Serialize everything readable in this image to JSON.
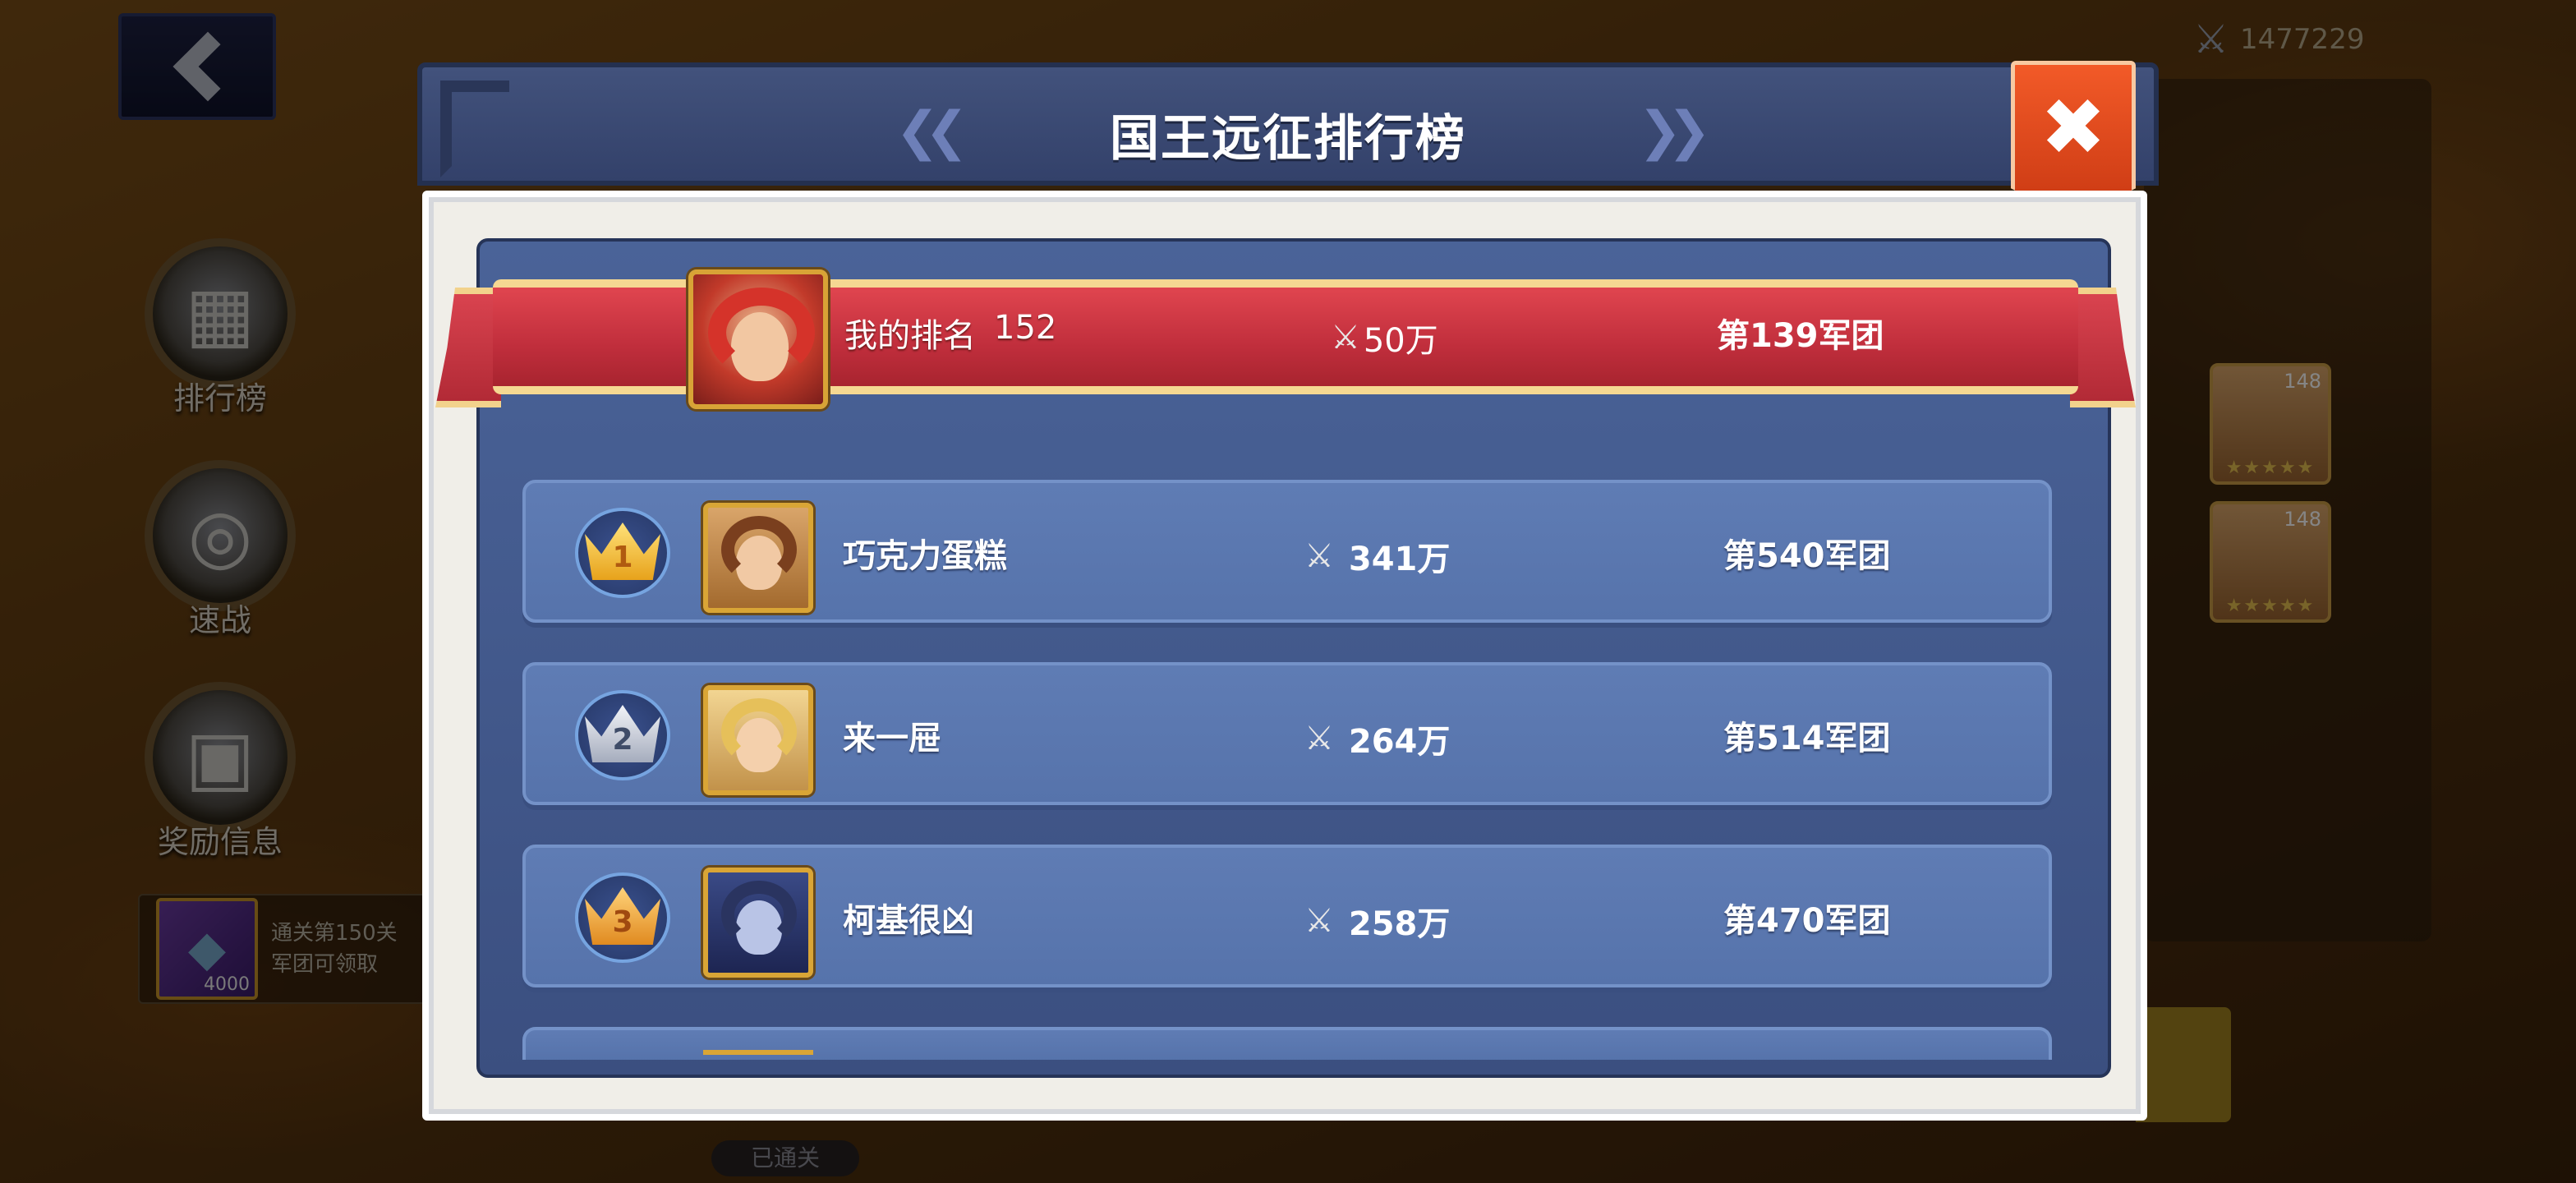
{
  "background": {
    "power_total": "1477229",
    "side_menu": [
      {
        "label": "排行榜"
      },
      {
        "label": "速战"
      },
      {
        "label": "奖励信息"
      }
    ],
    "reward": {
      "text_line1": "通关第150关",
      "text_line2": "军团可领取",
      "qty": "4000"
    },
    "heroes": [
      {
        "level": "148"
      },
      {
        "level": "148"
      }
    ],
    "cleared_label": "已通关"
  },
  "dialog": {
    "title": "国王远征排行榜",
    "prev_icon": "double-chevron-left",
    "next_icon": "double-chevron-right",
    "close_icon": "close-x",
    "my_rank": {
      "label": "我的排名",
      "rank": "152",
      "power": "50万",
      "legion": "第139军团"
    },
    "rankings": [
      {
        "rank": "1",
        "medal": "gold",
        "name": "巧克力蛋糕",
        "power": "341万",
        "legion": "第540军团"
      },
      {
        "rank": "2",
        "medal": "silver",
        "name": "来一屉",
        "power": "264万",
        "legion": "第514军团"
      },
      {
        "rank": "3",
        "medal": "bronze",
        "name": "柯基很凶",
        "power": "258万",
        "legion": "第470军团"
      }
    ]
  },
  "colors": {
    "header": "#3b4a74",
    "list_bg": "#4a6398",
    "row_bg": "#5f7cb4",
    "ribbon_red": "#c02e3c",
    "close_orange": "#e6461c",
    "gold": "#d9a536"
  }
}
